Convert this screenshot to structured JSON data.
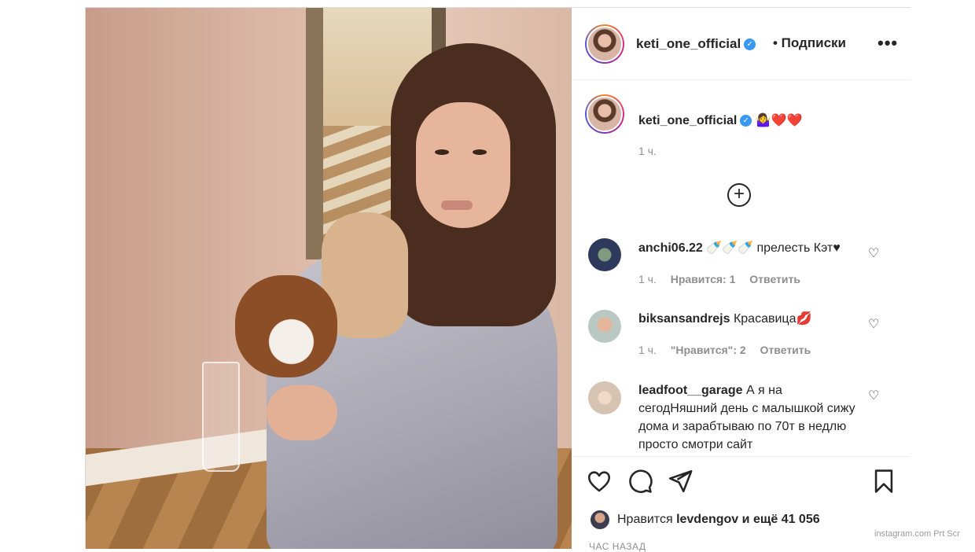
{
  "post": {
    "author": "keti_one_official",
    "follow_label": "• Подписки",
    "more_label": "•••",
    "caption_emojis": "🤷‍♀️❤️❤️",
    "caption_time": "1 ч.",
    "load_more_label": "+",
    "photo_alt": "keti_one_official"
  },
  "comments": [
    {
      "user": "anchi06.22",
      "text": "🍼🍼🍼 прелесть Кэт♥",
      "time": "1 ч.",
      "likes": "Нравится: 1",
      "reply": "Ответить",
      "avatar_color": "#2e3a5c"
    },
    {
      "user": "biksansandrejs",
      "text": "Красавица💋",
      "time": "1 ч.",
      "likes": "\"Нравится\": 2",
      "reply": "Ответить",
      "avatar_color": "#b9c8c2"
    },
    {
      "user": "leadfoot__garage",
      "text": "А я на сегодНяшний день с малышкой сижу дома и зарабтываю по 70т в недлю просто смотри сайт",
      "avatar_color": "#d7c3b2"
    }
  ],
  "actions": {
    "like_icon": "heart-icon",
    "comment_icon": "comment-icon",
    "share_icon": "share-icon",
    "save_icon": "bookmark-icon"
  },
  "likes_summary": {
    "prefix": "Нравится",
    "user": "levdengov",
    "suffix": "и ещё 41 056"
  },
  "time_ago": "ЧАС НАЗАД",
  "watermark": "instagram.com  Prt Scr"
}
